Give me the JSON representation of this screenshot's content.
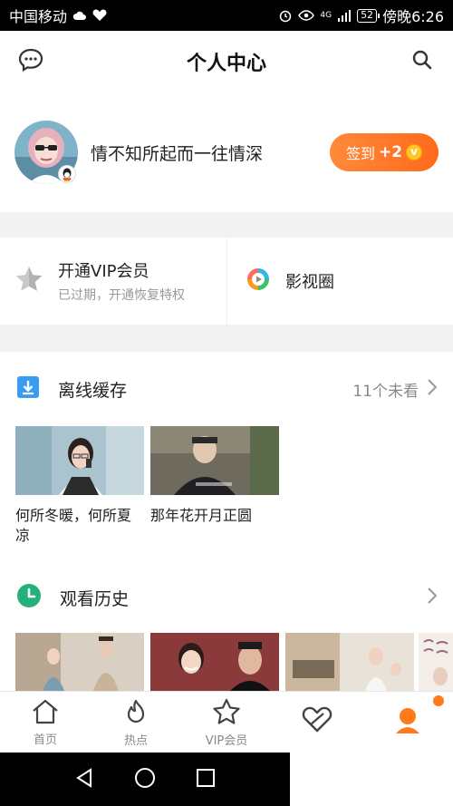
{
  "statusbar": {
    "carrier": "中国移动",
    "battery": "52",
    "time": "傍晚6:26",
    "network": "4G"
  },
  "header": {
    "title": "个人中心",
    "left_icon": "chat-bubble-icon",
    "right_icon": "search-icon"
  },
  "profile": {
    "username": "情不知所起而一往情深",
    "checkin_label": "签到",
    "checkin_bonus": "+2",
    "coin_symbol": "V"
  },
  "vip": {
    "title": "开通VIP会员",
    "subtitle": "已过期，开通恢复特权",
    "circle_title": "影视圈"
  },
  "offline": {
    "title": "离线缓存",
    "unwatched": "11个未看",
    "items": [
      {
        "label": "何所冬暖，何所夏凉"
      },
      {
        "label": "那年花开月正圆"
      }
    ]
  },
  "history": {
    "title": "观看历史"
  },
  "tabs": [
    {
      "label": "首页",
      "icon": "home-icon"
    },
    {
      "label": "热点",
      "icon": "flame-icon"
    },
    {
      "label": "VIP会员",
      "icon": "star-icon"
    },
    {
      "label": "",
      "icon": "heart-icon"
    },
    {
      "label": "",
      "icon": "user-icon"
    }
  ],
  "colors": {
    "accent": "#ff6a1a",
    "vip_blue": "#3a9cf0",
    "history_green": "#23b07a"
  }
}
